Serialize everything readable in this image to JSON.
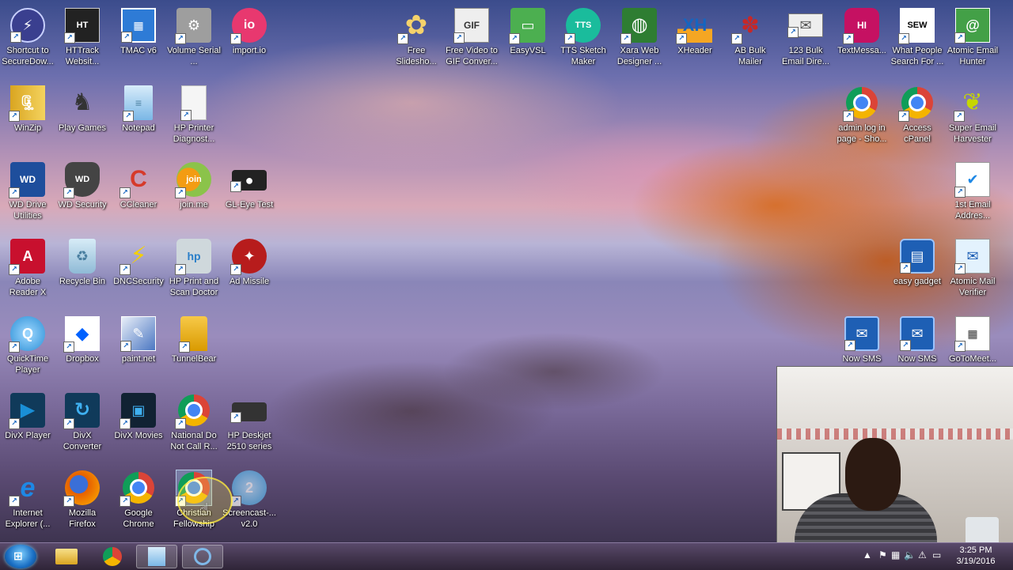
{
  "desktop": {
    "icons": [
      {
        "label": "Shortcut to SecureDow...",
        "icon": "lightning-icon",
        "color": "#3a3f8f"
      },
      {
        "label": "HTTrack Websit...",
        "icon": "httrack-icon",
        "color": "#333333"
      },
      {
        "label": "TMAC v6",
        "icon": "tmac-icon",
        "color": "#2e7bd6"
      },
      {
        "label": "Volume Serial ...",
        "icon": "volume-serial-icon",
        "color": "#8d8d8d"
      },
      {
        "label": "import.io",
        "icon": "import-io-icon",
        "color": "#e8386f"
      },
      {
        "label": "WinZip",
        "icon": "winzip-icon",
        "color": "#d9a521"
      },
      {
        "label": "Play Games",
        "icon": "chess-icon",
        "color": "#555555"
      },
      {
        "label": "Notepad",
        "icon": "notepad-icon",
        "color": "#7ab7e6"
      },
      {
        "label": "HP Printer Diagnost...",
        "icon": "document-icon",
        "color": "#f5f5f5"
      },
      {
        "label": "WD Drive Utilities",
        "icon": "wd-drive-icon",
        "color": "#1e4e9c"
      },
      {
        "label": "WD Security",
        "icon": "shield-icon",
        "color": "#444444"
      },
      {
        "label": "CCleaner",
        "icon": "ccleaner-icon",
        "color": "#d63a2a"
      },
      {
        "label": "join.me",
        "icon": "joinme-icon",
        "color": "#f39c12"
      },
      {
        "label": "GL-Eye Test",
        "icon": "camera-icon",
        "color": "#222222"
      },
      {
        "label": "Adobe Reader X",
        "icon": "adobe-icon",
        "color": "#c8102e"
      },
      {
        "label": "Recycle Bin",
        "icon": "recycle-bin-icon",
        "color": "#9ec9e6"
      },
      {
        "label": "DNCSecurity",
        "icon": "lightning-icon",
        "color": "#f5d000"
      },
      {
        "label": "HP Print and Scan Doctor",
        "icon": "hp-icon",
        "color": "#2a7fc9"
      },
      {
        "label": "Ad Missile",
        "icon": "ad-missile-icon",
        "color": "#b71c1c"
      },
      {
        "label": "QuickTime Player",
        "icon": "quicktime-icon",
        "color": "#2b8fd6"
      },
      {
        "label": "Dropbox",
        "icon": "dropbox-icon",
        "color": "#0061fe"
      },
      {
        "label": "paint.net",
        "icon": "paintnet-icon",
        "color": "#4b77c2"
      },
      {
        "label": "TunnelBear",
        "icon": "tunnelbear-icon",
        "color": "#f2b705"
      },
      {
        "label": "DivX Player",
        "icon": "play-icon",
        "color": "#1a8fd6"
      },
      {
        "label": "DivX Converter",
        "icon": "convert-icon",
        "color": "#1a6fb0"
      },
      {
        "label": "DivX Movies",
        "icon": "movies-icon",
        "color": "#1f7a5a"
      },
      {
        "label": "National Do Not Call R...",
        "icon": "chrome-icon",
        "color": "#4285f4"
      },
      {
        "label": "HP Deskjet 2510 series",
        "icon": "printer-icon",
        "color": "#333333"
      },
      {
        "label": "Internet Explorer (...",
        "icon": "ie-icon",
        "color": "#1e88e5"
      },
      {
        "label": "Mozilla Firefox",
        "icon": "firefox-icon",
        "color": "#e66000"
      },
      {
        "label": "Google Chrome",
        "icon": "chrome-icon",
        "color": "#4285f4"
      },
      {
        "label": "Christian Fellowship",
        "icon": "chrome-icon",
        "color": "#4285f4"
      },
      {
        "label": "Screencast-... v2.0",
        "icon": "screencast-icon",
        "color": "#3aa3e3"
      },
      {
        "label": "Free Slidesho...",
        "icon": "flower-icon",
        "color": "#f5d26b"
      },
      {
        "label": "Free Video to GIF Conver...",
        "icon": "gif-icon",
        "color": "#6aa84f"
      },
      {
        "label": "EasyVSL",
        "icon": "easyvsl-icon",
        "color": "#4caf50"
      },
      {
        "label": "TTS Sketch Maker",
        "icon": "tts-icon",
        "color": "#1abc9c"
      },
      {
        "label": "Xara Web Designer ...",
        "icon": "globe-icon",
        "color": "#2e7d32"
      },
      {
        "label": "XHeader",
        "icon": "xheader-icon",
        "color": "#1565c0"
      },
      {
        "label": "AB Bulk Mailer",
        "icon": "paw-icon",
        "color": "#c62828"
      },
      {
        "label": "123 Bulk Email Dire...",
        "icon": "envelope-icon",
        "color": "#eeeeee"
      },
      {
        "label": "TextMessa...",
        "icon": "phone-icon",
        "color": "#c51162"
      },
      {
        "label": "What People Search For ...",
        "icon": "search-word-icon",
        "color": "#ffffff"
      },
      {
        "label": "Atomic Email Hunter",
        "icon": "atomic-email-icon",
        "color": "#43a047"
      },
      {
        "label": "admin log in page - Sho...",
        "icon": "chrome-icon",
        "color": "#4285f4"
      },
      {
        "label": "Access cPanel",
        "icon": "chrome-icon",
        "color": "#4285f4"
      },
      {
        "label": "Super Email Harvester",
        "icon": "harvester-icon",
        "color": "#c6d600"
      },
      {
        "label": "1st Email Addres...",
        "icon": "email-check-icon",
        "color": "#ffffff"
      },
      {
        "label": "easy gadget",
        "icon": "gadget-icon",
        "color": "#1e5fb4"
      },
      {
        "label": "Atomic Mail Verifier",
        "icon": "mail-verifier-icon",
        "color": "#e3f2fd"
      },
      {
        "label": "Now SMS",
        "icon": "mail-icon",
        "color": "#1e5fb4"
      },
      {
        "label": "Now SMS",
        "icon": "mail-icon",
        "color": "#1e5fb4"
      },
      {
        "label": "GoToMeet...",
        "icon": "calendar-icon",
        "color": "#ffffff"
      }
    ]
  },
  "taskbar": {
    "start": "start-button",
    "clock_time": "3:25 PM",
    "clock_date": "3/19/2016"
  }
}
